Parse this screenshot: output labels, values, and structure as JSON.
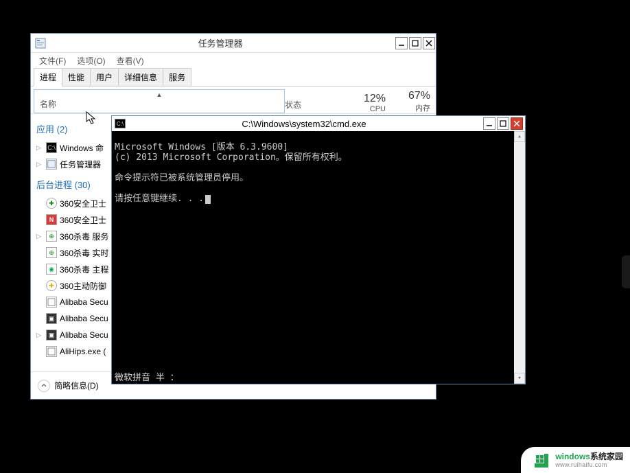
{
  "taskmgr": {
    "title": "任务管理器",
    "menu": {
      "file": "文件(F)",
      "options": "选项(O)",
      "view": "查看(V)"
    },
    "tabs": {
      "processes": "进程",
      "performance": "性能",
      "users": "用户",
      "details": "详细信息",
      "services": "服务"
    },
    "columns": {
      "name": "名称",
      "status": "状态",
      "cpu_pct": "12%",
      "cpu_lbl": "CPU",
      "mem_pct": "67%",
      "mem_lbl": "内存"
    },
    "groups": {
      "apps": "应用 (2)",
      "background": "后台进程 (30)"
    },
    "apps": [
      {
        "name": "Windows 命"
      },
      {
        "name": "任务管理器"
      }
    ],
    "bgprocs": [
      {
        "name": "360安全卫士"
      },
      {
        "name": "360安全卫士"
      },
      {
        "name": "360杀毒 服务"
      },
      {
        "name": "360杀毒 实时"
      },
      {
        "name": "360杀毒 主程"
      },
      {
        "name": "360主动防御"
      },
      {
        "name": "Alibaba Secu"
      },
      {
        "name": "Alibaba Secu"
      },
      {
        "name": "Alibaba Secu"
      },
      {
        "name": "AliHips.exe ("
      }
    ],
    "footer": "简略信息(D)"
  },
  "cmd": {
    "title": "C:\\Windows\\system32\\cmd.exe",
    "line1": "Microsoft Windows [版本 6.3.9600]",
    "line2": "(c) 2013 Microsoft Corporation。保留所有权利。",
    "line3": "命令提示符已被系统管理员停用。",
    "line4": "请按任意键继续. . .",
    "ime": "微软拼音 半 ："
  },
  "watermark": {
    "text1a": "windows",
    "text1b": "系统家园",
    "text2": "www.ruihaifu.com"
  }
}
